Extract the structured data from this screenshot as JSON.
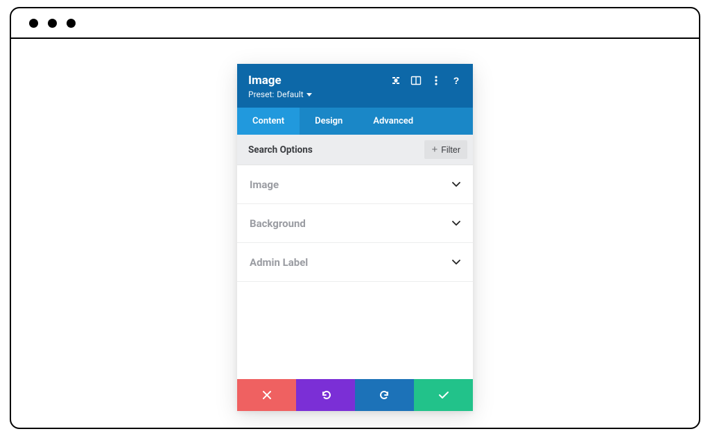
{
  "header": {
    "title": "Image",
    "preset_prefix": "Preset:",
    "preset_value": "Default"
  },
  "tabs": [
    {
      "label": "Content",
      "active": true
    },
    {
      "label": "Design",
      "active": false
    },
    {
      "label": "Advanced",
      "active": false
    }
  ],
  "search": {
    "label": "Search Options",
    "filter_label": "Filter"
  },
  "sections": [
    {
      "label": "Image"
    },
    {
      "label": "Background"
    },
    {
      "label": "Admin Label"
    }
  ],
  "actions": {
    "cancel": "cancel",
    "undo": "undo",
    "redo": "redo",
    "save": "save"
  },
  "colors": {
    "header_bg": "#0d68a8",
    "tabs_bg": "#1a87c7",
    "tab_active_bg": "#2199dd",
    "cancel": "#ef6161",
    "undo": "#7b2fd6",
    "redo": "#1c72b8",
    "save": "#22c28a"
  }
}
